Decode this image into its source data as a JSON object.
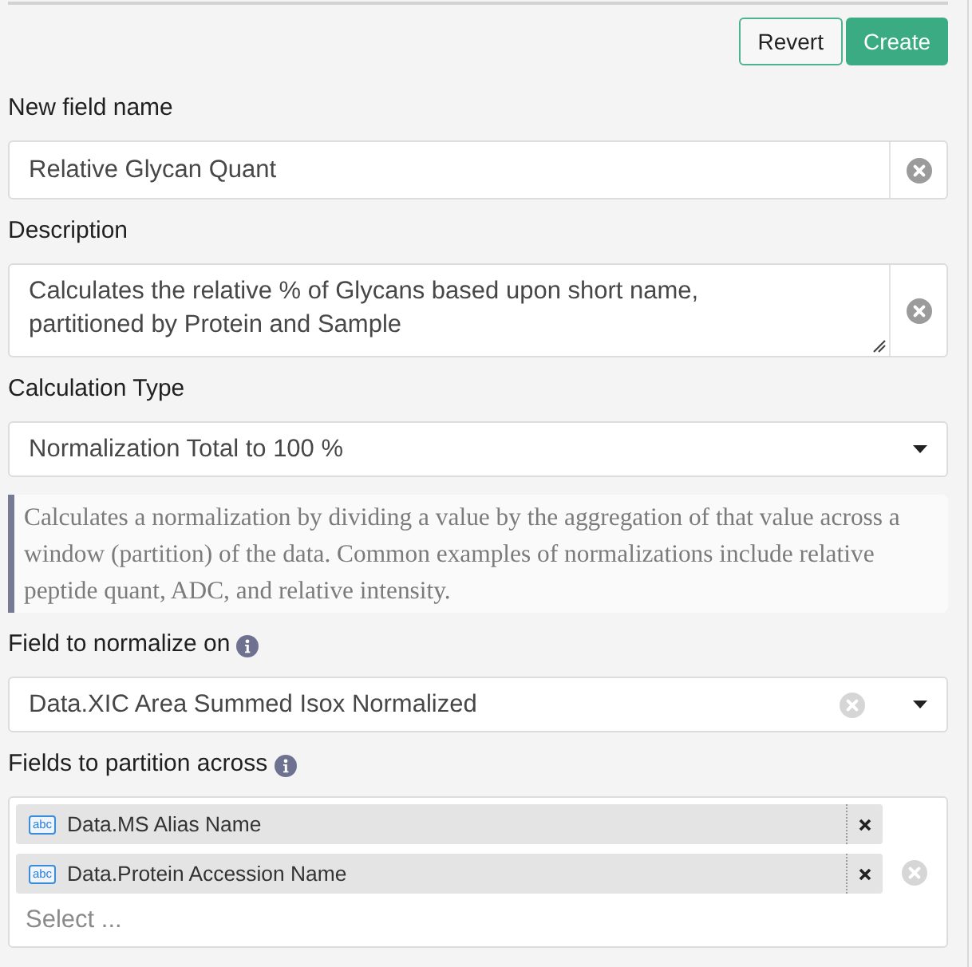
{
  "actions": [
    {
      "label": "Revert",
      "kind": "secondary"
    },
    {
      "label": "Create",
      "kind": "primary"
    }
  ],
  "fields": [
    {
      "kind": "text",
      "label": "New field name",
      "info": false,
      "value": "Relative Glycan Quant"
    },
    {
      "kind": "textarea",
      "label": "Description",
      "info": false,
      "value": "Calculates the relative % of Glycans based upon short name, partitioned by Protein and Sample"
    },
    {
      "kind": "select",
      "label": "Calculation Type",
      "info": false,
      "value": "Normalization Total to 100 %",
      "clearable": false,
      "help": "Calculates a normalization by dividing a value by the aggregation of that value across a window (partition) of the data. Common examples of normalizations include relative peptide quant, ADC, and relative intensity."
    },
    {
      "kind": "select",
      "label": "Field to normalize on",
      "info": true,
      "value": "Data.XIC Area Summed Isox Normalized",
      "clearable": true
    },
    {
      "kind": "multiselect",
      "label": "Fields to partition across",
      "info": true,
      "tags": [
        {
          "badge": "abc",
          "label": "Data.MS Alias Name"
        },
        {
          "badge": "abc",
          "label": "Data.Protein Accession Name"
        }
      ],
      "placeholder": "Select ..."
    }
  ]
}
